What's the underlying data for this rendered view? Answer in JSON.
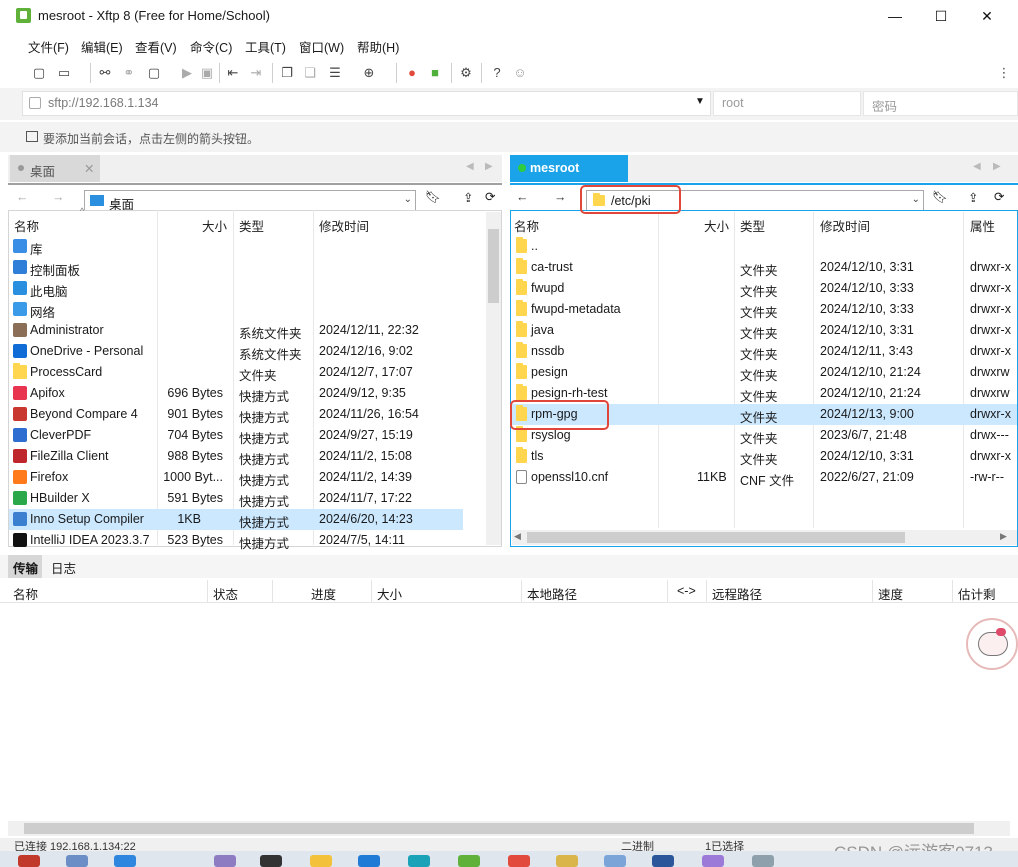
{
  "window": {
    "title": "mesroot - Xftp 8 (Free for Home/School)",
    "min": "—",
    "max": "☐",
    "close": "✕"
  },
  "menu": [
    "文件(F)",
    "编辑(E)",
    "查看(V)",
    "命令(C)",
    "工具(T)",
    "窗口(W)",
    "帮助(H)"
  ],
  "connection": {
    "address": "sftp://192.168.1.134",
    "user_placeholder": "root",
    "password_placeholder": "密码",
    "hint": "要添加当前会话，点击左侧的箭头按钮。"
  },
  "left": {
    "tab": "桌面",
    "path": "桌面",
    "columns": [
      "名称",
      "大小",
      "类型",
      "修改时间"
    ],
    "rows": [
      {
        "name": "库",
        "size": "",
        "type": "",
        "modified": "",
        "icon": "library-icon",
        "color": "#3a8ee6"
      },
      {
        "name": "控制面板",
        "size": "",
        "type": "",
        "modified": "",
        "icon": "control-panel-icon",
        "color": "#2f7fd8"
      },
      {
        "name": "此电脑",
        "size": "",
        "type": "",
        "modified": "",
        "icon": "computer-icon",
        "color": "#2b8fe0"
      },
      {
        "name": "网络",
        "size": "",
        "type": "",
        "modified": "",
        "icon": "network-icon",
        "color": "#3b9be8"
      },
      {
        "name": "Administrator",
        "size": "",
        "type": "系统文件夹",
        "modified": "2024/12/11, 22:32",
        "icon": "user-icon",
        "color": "#8a6e55"
      },
      {
        "name": "OneDrive - Personal",
        "size": "",
        "type": "系统文件夹",
        "modified": "2024/12/16, 9:02",
        "icon": "onedrive-icon",
        "color": "#0f6cd6"
      },
      {
        "name": "ProcessCard",
        "size": "",
        "type": "文件夹",
        "modified": "2024/12/7, 17:07",
        "icon": "folder-icon",
        "color": "#ffd64d"
      },
      {
        "name": "Apifox",
        "size": "696 Bytes",
        "type": "快捷方式",
        "modified": "2024/9/12, 9:35",
        "icon": "apifox-icon",
        "color": "#e8344e"
      },
      {
        "name": "Beyond Compare 4",
        "size": "901 Bytes",
        "type": "快捷方式",
        "modified": "2024/11/26, 16:54",
        "icon": "beyond-compare-icon",
        "color": "#c8382e"
      },
      {
        "name": "CleverPDF",
        "size": "704 Bytes",
        "type": "快捷方式",
        "modified": "2024/9/27, 15:19",
        "icon": "cleverpdf-icon",
        "color": "#2d6ed0"
      },
      {
        "name": "FileZilla Client",
        "size": "988 Bytes",
        "type": "快捷方式",
        "modified": "2024/11/2, 15:08",
        "icon": "filezilla-icon",
        "color": "#c0272d"
      },
      {
        "name": "Firefox",
        "size": "1000 Byt...",
        "type": "快捷方式",
        "modified": "2024/11/2, 14:39",
        "icon": "firefox-icon",
        "color": "#ff7a1a"
      },
      {
        "name": "HBuilder X",
        "size": "591 Bytes",
        "type": "快捷方式",
        "modified": "2024/11/7, 17:22",
        "icon": "hbuilder-icon",
        "color": "#2aa84a"
      },
      {
        "name": "Inno Setup Compiler",
        "size": "1KB",
        "type": "快捷方式",
        "modified": "2024/6/20, 14:23",
        "icon": "inno-setup-icon",
        "color": "#3b7fd0",
        "selected": true
      },
      {
        "name": "IntelliJ IDEA 2023.3.7",
        "size": "523 Bytes",
        "type": "快捷方式",
        "modified": "2024/7/5, 14:11",
        "icon": "intellij-icon",
        "color": "#111111"
      }
    ]
  },
  "right": {
    "tab": "mesroot",
    "path": "/etc/pki",
    "columns": [
      "名称",
      "大小",
      "类型",
      "修改时间",
      "属性"
    ],
    "rows": [
      {
        "name": "..",
        "size": "",
        "type": "",
        "modified": "",
        "attr": "",
        "icon": "folder-icon"
      },
      {
        "name": "ca-trust",
        "size": "",
        "type": "文件夹",
        "modified": "2024/12/10, 3:31",
        "attr": "drwxr-x",
        "icon": "folder-icon"
      },
      {
        "name": "fwupd",
        "size": "",
        "type": "文件夹",
        "modified": "2024/12/10, 3:33",
        "attr": "drwxr-x",
        "icon": "folder-icon"
      },
      {
        "name": "fwupd-metadata",
        "size": "",
        "type": "文件夹",
        "modified": "2024/12/10, 3:33",
        "attr": "drwxr-x",
        "icon": "folder-icon"
      },
      {
        "name": "java",
        "size": "",
        "type": "文件夹",
        "modified": "2024/12/10, 3:31",
        "attr": "drwxr-x",
        "icon": "folder-icon"
      },
      {
        "name": "nssdb",
        "size": "",
        "type": "文件夹",
        "modified": "2024/12/11, 3:43",
        "attr": "drwxr-x",
        "icon": "folder-icon"
      },
      {
        "name": "pesign",
        "size": "",
        "type": "文件夹",
        "modified": "2024/12/10, 21:24",
        "attr": "drwxrw",
        "icon": "folder-icon"
      },
      {
        "name": "pesign-rh-test",
        "size": "",
        "type": "文件夹",
        "modified": "2024/12/10, 21:24",
        "attr": "drwxrw",
        "icon": "folder-icon"
      },
      {
        "name": "rpm-gpg",
        "size": "",
        "type": "文件夹",
        "modified": "2024/12/13, 9:00",
        "attr": "drwxr-x",
        "icon": "folder-icon",
        "selected": true
      },
      {
        "name": "rsyslog",
        "size": "",
        "type": "文件夹",
        "modified": "2023/6/7, 21:48",
        "attr": "drwx---",
        "icon": "folder-icon"
      },
      {
        "name": "tls",
        "size": "",
        "type": "文件夹",
        "modified": "2024/12/10, 3:31",
        "attr": "drwxr-x",
        "icon": "folder-icon"
      },
      {
        "name": "openssl10.cnf",
        "size": "11KB",
        "type": "CNF 文件",
        "modified": "2022/6/27, 21:09",
        "attr": "-rw-r--",
        "icon": "file-icon"
      }
    ]
  },
  "bottom": {
    "tabs": [
      "传输",
      "日志"
    ],
    "columns": [
      "名称",
      "状态",
      "进度",
      "大小",
      "本地路径",
      "<->",
      "远程路径",
      "速度",
      "估计剩余..."
    ]
  },
  "status": {
    "left": "已连接 192.168.1.134:22",
    "mode": "二进制",
    "selected": "1已选择",
    "watermark": "CSDN @远游客0713"
  },
  "colors": {
    "accent": "#1aa3e8",
    "selection": "#cce8ff",
    "annotation": "#e0463a",
    "connected": "#2ecc40"
  }
}
